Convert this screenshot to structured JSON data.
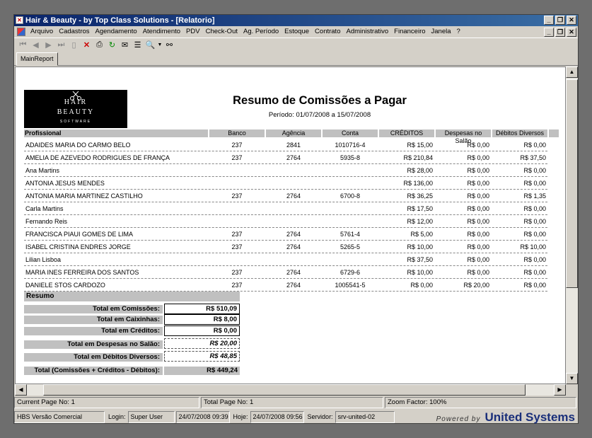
{
  "window": {
    "title": "Hair & Beauty - by Top Class Solutions - [Relatorio]"
  },
  "menu": [
    "Arquivo",
    "Cadastros",
    "Agendamento",
    "Atendimento",
    "PDV",
    "Check-Out",
    "Ag. Período",
    "Estoque",
    "Contrato",
    "Administrativo",
    "Financeiro",
    "Janela",
    "?"
  ],
  "toolbar": [
    "first-page-icon",
    "prev-page-icon",
    "next-page-icon",
    "last-page-icon",
    "blank-page-icon",
    "close-icon",
    "print-icon",
    "refresh-icon",
    "export-icon",
    "tree-icon",
    "zoom-icon",
    "dropdown-arrow-icon",
    "binoculars-icon"
  ],
  "tab": {
    "label": "MainReport"
  },
  "report": {
    "logo": {
      "line1": "HAIR",
      "line2": "BEAUTY",
      "line3": "SOFTWARE"
    },
    "title": "Resumo de Comissões a Pagar",
    "period": "Período: 01/07/2008  a   15/07/2008",
    "columns": [
      "Profissional",
      "Banco",
      "Agência",
      "Conta",
      "CRÉDITOS",
      "Despesas no Salão",
      "Débitos Diversos"
    ],
    "rows": [
      {
        "name": "ADAIDES MARIA DO CARMO BELO",
        "banco": "237",
        "agencia": "2841",
        "conta": "1010716-4",
        "creditos": "R$ 15,00",
        "despesas": "R$ 0,00",
        "debitos": "R$ 0,00"
      },
      {
        "name": "AMELIA DE AZEVEDO RODRIGUES DE FRANÇA",
        "banco": "237",
        "agencia": "2764",
        "conta": "5935-8",
        "creditos": "R$ 210,84",
        "despesas": "R$ 0,00",
        "debitos": "R$ 37,50"
      },
      {
        "name": "Ana Martins",
        "banco": "",
        "agencia": "",
        "conta": "",
        "creditos": "R$ 28,00",
        "despesas": "R$ 0,00",
        "debitos": "R$ 0,00"
      },
      {
        "name": "ANTONIA JESUS MENDES",
        "banco": "",
        "agencia": "",
        "conta": "",
        "creditos": "R$ 136,00",
        "despesas": "R$ 0,00",
        "debitos": "R$ 0,00"
      },
      {
        "name": "ANTONIA MARIA MARTINEZ CASTILHO",
        "banco": "237",
        "agencia": "2764",
        "conta": "6700-8",
        "creditos": "R$ 36,25",
        "despesas": "R$ 0,00",
        "debitos": "R$ 1,35"
      },
      {
        "name": "Carla Martins",
        "banco": "",
        "agencia": "",
        "conta": "",
        "creditos": "R$ 17,50",
        "despesas": "R$ 0,00",
        "debitos": "R$ 0,00"
      },
      {
        "name": "Fernando Reis",
        "banco": "",
        "agencia": "",
        "conta": "",
        "creditos": "R$ 12,00",
        "despesas": "R$ 0,00",
        "debitos": "R$ 0,00"
      },
      {
        "name": "FRANCISCA PIAUI GOMES DE LIMA",
        "banco": "237",
        "agencia": "2764",
        "conta": "5761-4",
        "creditos": "R$ 5,00",
        "despesas": "R$ 0,00",
        "debitos": "R$ 0,00"
      },
      {
        "name": "ISABEL CRISTINA ENDRES JORGE",
        "banco": "237",
        "agencia": "2764",
        "conta": "5265-5",
        "creditos": "R$ 10,00",
        "despesas": "R$ 0,00",
        "debitos": "R$ 10,00"
      },
      {
        "name": "Lilian Lisboa",
        "banco": "",
        "agencia": "",
        "conta": "",
        "creditos": "R$ 37,50",
        "despesas": "R$ 0,00",
        "debitos": "R$ 0,00"
      },
      {
        "name": "MARIA INES FERREIRA DOS SANTOS",
        "banco": "237",
        "agencia": "2764",
        "conta": "6729-6",
        "creditos": "R$ 10,00",
        "despesas": "R$ 0,00",
        "debitos": "R$ 0,00"
      },
      {
        "name": "DANIELE  STOS CARDOZO",
        "banco": "237",
        "agencia": "2764",
        "conta": "1005541-5",
        "creditos": "R$ 0,00",
        "despesas": "R$ 20,00",
        "debitos": "R$ 0,00"
      }
    ],
    "summary": {
      "heading": "Resumo",
      "items": [
        {
          "label": "Total em Comissões:",
          "value": "R$ 510,09"
        },
        {
          "label": "Total em Caixinhas:",
          "value": "R$ 8,00"
        },
        {
          "label": "Total em Créditos:",
          "value": "R$ 0,00"
        },
        {
          "label": "Total em Despesas no Salão:",
          "value": "R$ 20,00"
        },
        {
          "label": "Total em Débitos Diversos:",
          "value": "R$ 48,85"
        },
        {
          "label": "Total (Comissões + Créditos - Débitos):",
          "value": "R$ 449,24"
        }
      ]
    }
  },
  "status": {
    "current_page": "Current Page No: 1",
    "total_page": "Total Page No: 1",
    "zoom": "Zoom Factor: 100%",
    "version": "HBS Versão Comercial",
    "login_label": "Login:",
    "login_value": "Super User",
    "datetime": "24/07/2008 09:39",
    "hoje_label": "Hoje:",
    "hoje_value": "24/07/2008 09:56",
    "servidor_label": "Servidor:",
    "servidor_value": "srv-united-02",
    "powered": "Powered by",
    "brand": "United Systems"
  }
}
